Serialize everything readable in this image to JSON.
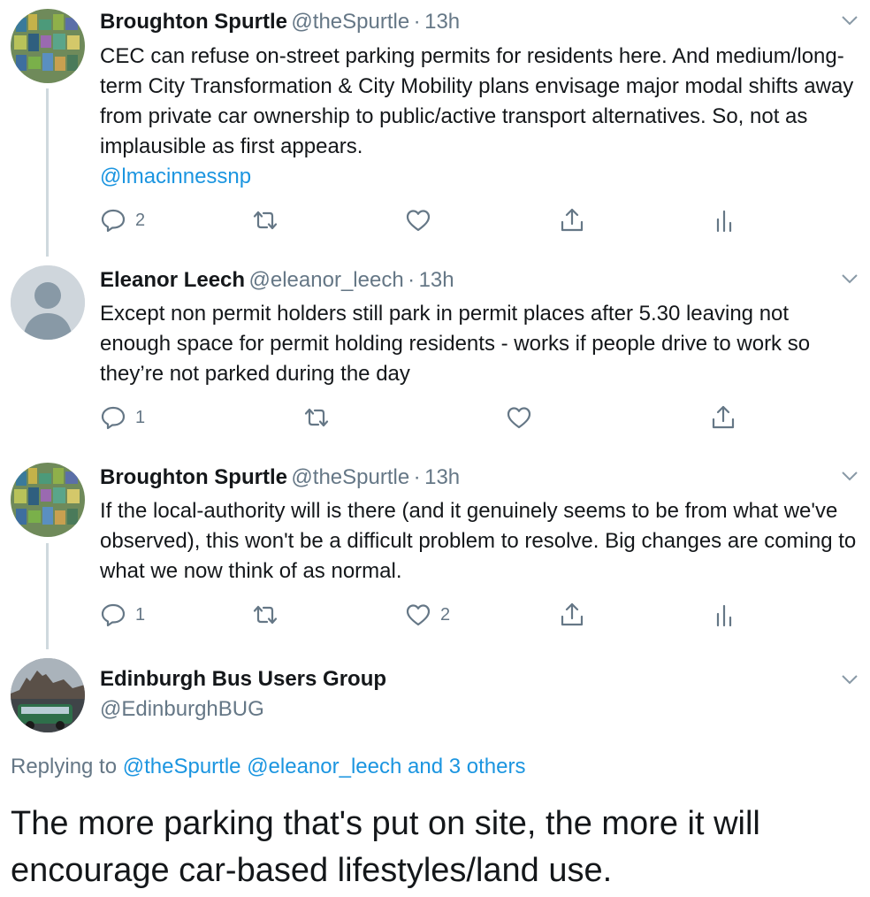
{
  "tweets": [
    {
      "name": "Broughton Spurtle",
      "handle": "@theSpurtle",
      "sep": "·",
      "time": "13h",
      "text": "CEC can refuse on-street parking permits for residents here. And medium/long-term City Transformation & City Mobility plans envisage major modal shifts away from private car ownership to public/active transport alternatives. So, not as implausible as first appears.",
      "mention": "@lmacinnessnp",
      "replies": "2",
      "retweets": "",
      "likes": ""
    },
    {
      "name": "Eleanor Leech",
      "handle": "@eleanor_leech",
      "sep": "·",
      "time": "13h",
      "text": "Except non permit holders still park in permit places after 5.30 leaving not enough space for permit holding residents - works if people drive to work so they’re not parked during the day",
      "replies": "1",
      "retweets": "",
      "likes": ""
    },
    {
      "name": "Broughton Spurtle",
      "handle": "@theSpurtle",
      "sep": "·",
      "time": "13h",
      "text": "If the local-authority will is there (and it genuinely seems to be from what we've observed), this won't be a difficult problem to resolve. Big changes are coming to what we now think of as normal.",
      "replies": "1",
      "retweets": "",
      "likes": "2"
    }
  ],
  "main_tweet": {
    "name": "Edinburgh Bus Users Group",
    "handle": "@EdinburghBUG",
    "replying_prefix": "Replying to",
    "replying_to": "@theSpurtle @eleanor_leech",
    "replying_and": "and",
    "replying_others": "3 others",
    "text": "The more parking that's put on site, the more it will encourage car-based lifestyles/land use."
  },
  "colors": {
    "link": "#1b95e0",
    "muted": "#657786",
    "thread_line": "#cfd9de",
    "text": "#14171a"
  },
  "icons": [
    "reply-icon",
    "retweet-icon",
    "like-icon",
    "share-icon",
    "analytics-icon",
    "caret-down-icon"
  ]
}
